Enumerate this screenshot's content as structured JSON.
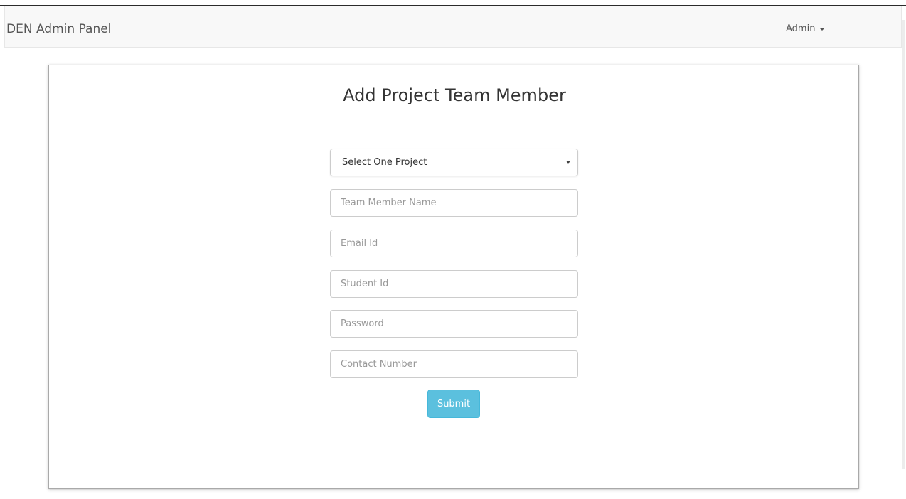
{
  "navbar": {
    "brand": "DEN Admin Panel",
    "user_label": "Admin"
  },
  "form": {
    "title": "Add Project Team Member",
    "project_select": {
      "selected": "Select One Project"
    },
    "fields": {
      "member_name_placeholder": "Team Member Name",
      "email_placeholder": "Email Id",
      "student_id_placeholder": "Student Id",
      "password_placeholder": "Password",
      "contact_placeholder": "Contact Number"
    },
    "submit_label": "Submit"
  },
  "colors": {
    "navbar_bg": "#f8f8f8",
    "submit_bg": "#5bc0de",
    "card_border": "#a9a9a9"
  }
}
